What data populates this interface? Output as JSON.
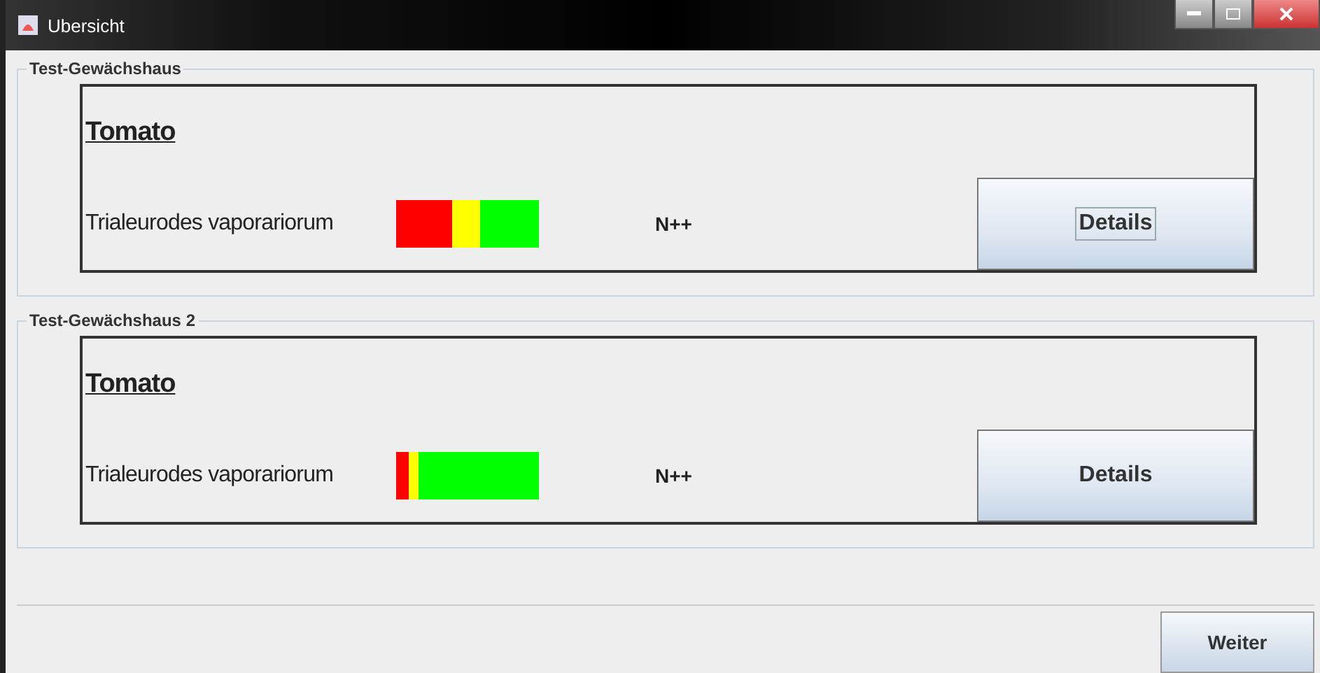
{
  "window": {
    "title": "Ubersicht"
  },
  "groups": [
    {
      "title": "Test-Gewächshaus",
      "plant": "Tomato",
      "pest": "Trialeurodes vaporariorum",
      "bar": {
        "color": "#00ff00",
        "segments": [
          {
            "color": "#ff0000",
            "level": 0.39
          },
          {
            "color": "#ffff00",
            "level": 0.59
          }
        ]
      },
      "code": "N++",
      "button": {
        "label": "Details",
        "focused": true
      }
    },
    {
      "title": "Test-Gewächshaus 2",
      "plant": "Tomato",
      "pest": "Trialeurodes vaporariorum",
      "bar": {
        "color": "#00ff00",
        "segments": [
          {
            "color": "#ff0000",
            "level": 0.09
          },
          {
            "color": "#ffff00",
            "level": 0.16
          }
        ]
      },
      "code": "N++",
      "button": {
        "label": "Details",
        "focused": false
      }
    }
  ],
  "footer": {
    "button": "Weiter"
  }
}
